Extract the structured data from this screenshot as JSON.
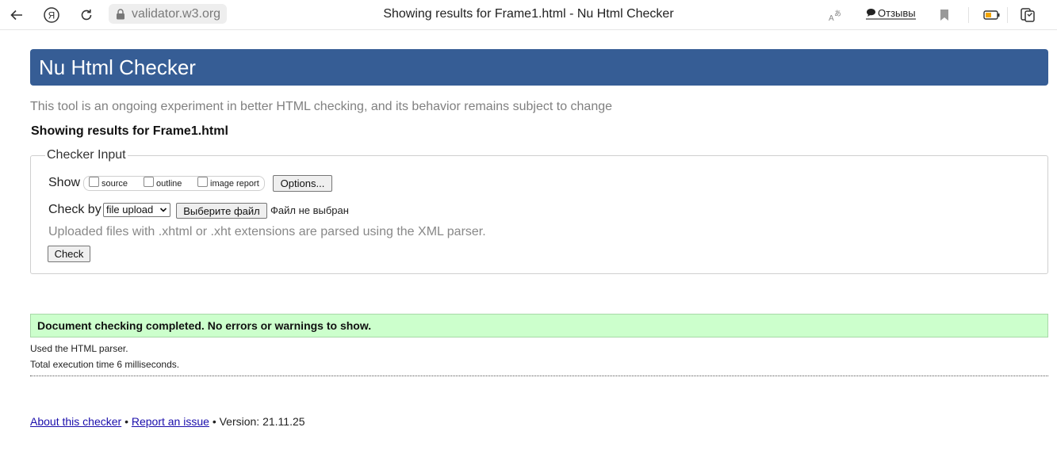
{
  "browser": {
    "url": "validator.w3.org",
    "tab_title": "Showing results for Frame1.html - Nu Html Checker",
    "reviews_label": "Отзывы",
    "icons": [
      "back-arrow-icon",
      "yandex-icon",
      "reload-icon",
      "lock-icon",
      "translate-icon",
      "comment-icon",
      "bookmark-icon",
      "battery-icon",
      "collections-icon"
    ]
  },
  "page": {
    "header": "Nu Html Checker",
    "subtitle": "This tool is an ongoing experiment in better HTML checking, and its behavior remains subject to change",
    "results_for": "Showing results for Frame1.html"
  },
  "checker": {
    "legend": "Checker Input",
    "show_label": "Show",
    "options": [
      {
        "label": "source",
        "checked": false
      },
      {
        "label": "outline",
        "checked": false
      },
      {
        "label": "image report",
        "checked": false
      }
    ],
    "options_button": "Options...",
    "check_by_label": "Check by",
    "check_by_value": "file upload",
    "choose_file_button": "Выберите файл",
    "no_file_text": "Файл не выбран",
    "xml_note": "Uploaded files with .xhtml or .xht extensions are parsed using the XML parser.",
    "check_button": "Check"
  },
  "result": {
    "message": "Document checking completed. No errors or warnings to show.",
    "parser_note": "Used the HTML parser.",
    "time_note": "Total execution time 6 milliseconds."
  },
  "footer": {
    "about_link": "About this checker",
    "sep1": "•",
    "report_link": "Report an issue",
    "sep2": "•",
    "version": "Version: 21.11.25"
  },
  "colors": {
    "header_bg": "#365d95",
    "success_bg": "#ccffcc",
    "link": "#1a0dab"
  }
}
